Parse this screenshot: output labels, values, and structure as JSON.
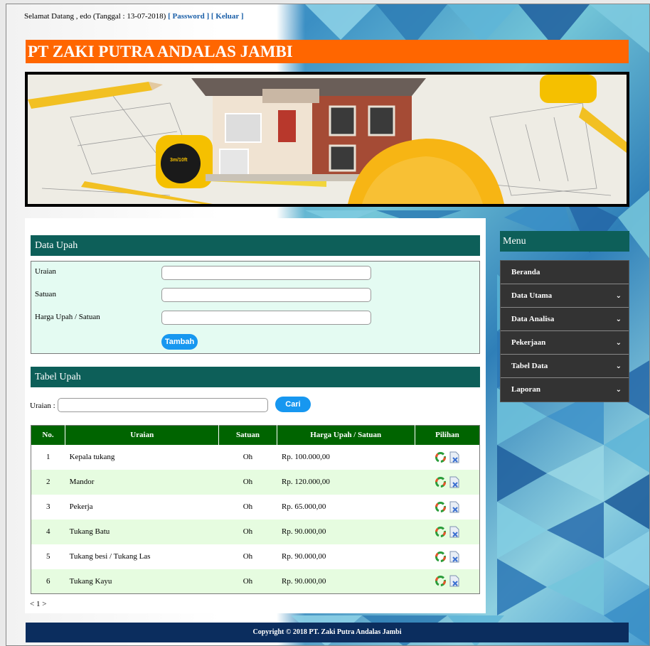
{
  "header": {
    "welcome_prefix": "Selamat Datang , edo (Tanggal : 13-07-2018)",
    "password_link": "[ Password ]",
    "logout_link": "[ Keluar ]",
    "site_title": "PT ZAKI PUTRA ANDALAS JAMBI"
  },
  "form": {
    "title": "Data Upah",
    "uraian_label": "Uraian",
    "satuan_label": "Satuan",
    "harga_label": "Harga Upah / Satuan",
    "uraian_value": "",
    "satuan_value": "",
    "harga_value": "",
    "submit_label": "Tambah"
  },
  "table_section": {
    "title": "Tabel Upah",
    "search_label": "Uraian :",
    "search_value": "",
    "search_button": "Cari",
    "columns": [
      "No.",
      "Uraian",
      "Satuan",
      "Harga Upah / Satuan",
      "Pilihan"
    ],
    "rows": [
      {
        "no": "1",
        "uraian": "Kepala tukang",
        "satuan": "Oh",
        "harga": "Rp. 100.000,00"
      },
      {
        "no": "2",
        "uraian": "Mandor",
        "satuan": "Oh",
        "harga": "Rp. 120.000,00"
      },
      {
        "no": "3",
        "uraian": "Pekerja",
        "satuan": "Oh",
        "harga": "Rp. 65.000,00"
      },
      {
        "no": "4",
        "uraian": "Tukang Batu",
        "satuan": "Oh",
        "harga": "Rp. 90.000,00"
      },
      {
        "no": "5",
        "uraian": "Tukang besi / Tukang Las",
        "satuan": "Oh",
        "harga": "Rp. 90.000,00"
      },
      {
        "no": "6",
        "uraian": "Tukang Kayu",
        "satuan": "Oh",
        "harga": "Rp. 90.000,00"
      }
    ],
    "pagination": "< 1 >"
  },
  "menu": {
    "title": "Menu",
    "items": [
      {
        "label": "Beranda",
        "has_submenu": false
      },
      {
        "label": "Data Utama",
        "has_submenu": true
      },
      {
        "label": "Data Analisa",
        "has_submenu": true
      },
      {
        "label": "Pekerjaan",
        "has_submenu": true
      },
      {
        "label": "Tabel Data",
        "has_submenu": true
      },
      {
        "label": "Laporan",
        "has_submenu": true
      }
    ]
  },
  "footer": {
    "copyright": "Copyright © 2018 PT. Zaki Putra Andalas Jambi"
  },
  "colors": {
    "title_bar": "#ff6600",
    "section_head": "#0d5f59",
    "table_head": "#006400",
    "button": "#1797f0",
    "footer": "#0b2d5e"
  },
  "icons": {
    "edit": "edit-icon",
    "delete": "delete-icon",
    "menu_chevron": "chevron-down-icon"
  }
}
